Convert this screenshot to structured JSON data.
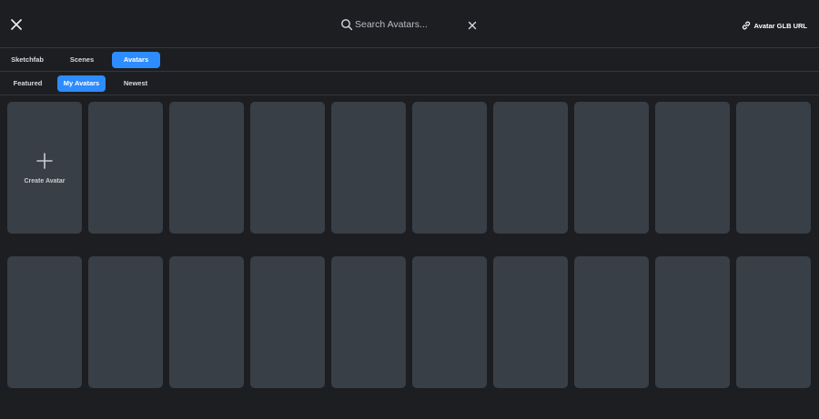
{
  "header": {
    "search_placeholder": "Search Avatars...",
    "avatar_glb_label": "Avatar GLB URL"
  },
  "source_tabs": [
    {
      "label": "Sketchfab",
      "active": false
    },
    {
      "label": "Scenes",
      "active": false
    },
    {
      "label": "Avatars",
      "active": true
    }
  ],
  "filter_tabs": [
    {
      "label": "Featured",
      "active": false
    },
    {
      "label": "My Avatars",
      "active": true
    },
    {
      "label": "Newest",
      "active": false
    }
  ],
  "grid": {
    "create_label": "Create Avatar"
  },
  "colors": {
    "accent": "#2d8cff",
    "background": "#1c1e22",
    "card": "#393f47"
  }
}
